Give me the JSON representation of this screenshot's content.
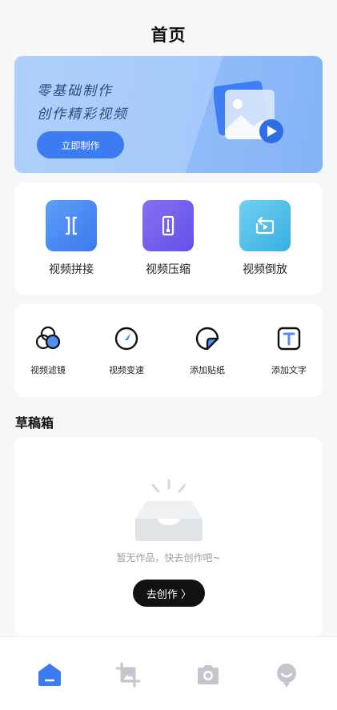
{
  "page": {
    "title": "首页"
  },
  "banner": {
    "line1": "零基础制作",
    "line2": "创作精彩视频",
    "button_label": "立即制作"
  },
  "tools": [
    {
      "label": "视频拼接",
      "icon": "merge-icon",
      "color": "#4f8ff5"
    },
    {
      "label": "视频压缩",
      "icon": "compress-icon",
      "color": "#7462ee"
    },
    {
      "label": "视频倒放",
      "icon": "reverse-icon",
      "color": "#3fb6e6"
    }
  ],
  "small_tools": [
    {
      "label": "视频滤镜",
      "icon": "filter-icon"
    },
    {
      "label": "视频变速",
      "icon": "speed-icon"
    },
    {
      "label": "添加贴纸",
      "icon": "sticker-icon"
    },
    {
      "label": "添加文字",
      "icon": "text-icon"
    }
  ],
  "drafts": {
    "title": "草稿箱",
    "empty_text": "暂无作品，快去创作吧~",
    "button_label": "去创作 〉"
  },
  "tabbar": [
    {
      "icon": "home-icon",
      "active": true
    },
    {
      "icon": "crop-icon",
      "active": false
    },
    {
      "icon": "camera-icon",
      "active": false
    },
    {
      "icon": "profile-icon",
      "active": false
    }
  ],
  "colors": {
    "accent": "#3d7bf0",
    "inactive": "#c3c6cc"
  }
}
